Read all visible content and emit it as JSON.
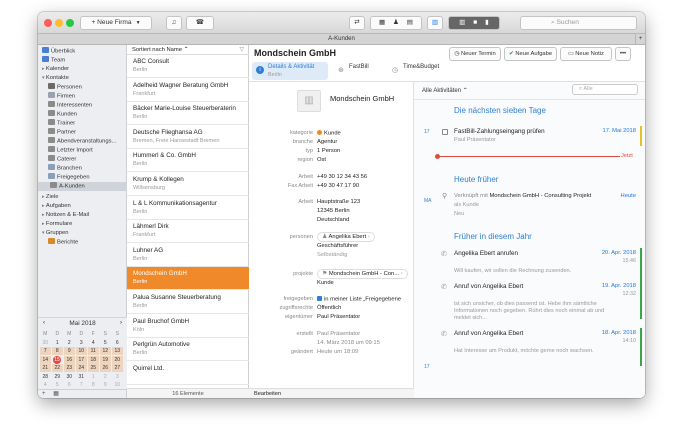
{
  "toolbar": {
    "new_firm": "Neue Firma",
    "search_placeholder": "Suchen"
  },
  "tabbar": {
    "title": "A-Kunden"
  },
  "sidebar": {
    "items": [
      {
        "label": "Überblick",
        "icon": "home-icon"
      },
      {
        "label": "Team",
        "icon": "team-icon"
      },
      {
        "label": "Kalender",
        "icon": "disclosure-icon"
      },
      {
        "label": "Kontakte",
        "icon": "disclosure-open-icon"
      },
      {
        "label": "Personen",
        "icon": "person-icon"
      },
      {
        "label": "Firmen",
        "icon": "company-icon"
      },
      {
        "label": "Interessenten",
        "icon": "person-group-icon"
      },
      {
        "label": "Kunden",
        "icon": "person-group-icon"
      },
      {
        "label": "Trainer",
        "icon": "person-group-icon"
      },
      {
        "label": "Partner",
        "icon": "person-group-icon"
      },
      {
        "label": "Abendveranstaltungs...",
        "icon": "person-group-icon"
      },
      {
        "label": "Letzter Import",
        "icon": "person-group-icon"
      },
      {
        "label": "Caterer",
        "icon": "person-group-icon"
      },
      {
        "label": "Branchen",
        "icon": "folder-icon"
      },
      {
        "label": "Freigegeben",
        "icon": "folder-icon"
      },
      {
        "label": "A-Kunden",
        "icon": "person-group-icon"
      },
      {
        "label": "Ziele",
        "icon": "disclosure-icon"
      },
      {
        "label": "Aufgaben",
        "icon": "disclosure-icon"
      },
      {
        "label": "Notizen & E-Mail",
        "icon": "disclosure-icon"
      },
      {
        "label": "Formulare",
        "icon": "disclosure-icon"
      },
      {
        "label": "Gruppen",
        "icon": "disclosure-open-icon"
      },
      {
        "label": "Berichte",
        "icon": "report-icon"
      }
    ],
    "calendar": {
      "title": "Mai 2018",
      "weekdays": [
        "M",
        "D",
        "M",
        "D",
        "F",
        "S",
        "S"
      ],
      "rows": [
        [
          "30",
          "1",
          "2",
          "3",
          "4",
          "5",
          "6"
        ],
        [
          "7",
          "8",
          "9",
          "10",
          "11",
          "12",
          "13"
        ],
        [
          "14",
          "15",
          "16",
          "17",
          "18",
          "19",
          "20"
        ],
        [
          "21",
          "22",
          "23",
          "24",
          "25",
          "26",
          "27"
        ],
        [
          "28",
          "29",
          "30",
          "31",
          "1",
          "2",
          "3"
        ],
        [
          "4",
          "5",
          "6",
          "7",
          "8",
          "9",
          "10"
        ]
      ],
      "today": "15"
    }
  },
  "list": {
    "sort_label": "Sortiert nach Name",
    "count": "16 Elemente",
    "items": [
      {
        "name": "ABC Consult",
        "city": "Berlin"
      },
      {
        "name": "Adelheid Wagner Beratung GmbH",
        "city": "Frankfurt"
      },
      {
        "name": "Bäcker Marie-Louise Steuerberaterin",
        "city": "Berlin"
      },
      {
        "name": "Deutsche Flieghansa AG",
        "city": "Bremen, Freie Hansestadt Bremen"
      },
      {
        "name": "Hummerl & Co. GmbH",
        "city": "Berlin"
      },
      {
        "name": "Krump & Kollegen",
        "city": "Willsensburg"
      },
      {
        "name": "L & L Kommunikationsagentur",
        "city": "Berlin"
      },
      {
        "name": "Lähmerl Dirk",
        "city": "Frankfurt"
      },
      {
        "name": "Luhner AG",
        "city": "Berlin"
      },
      {
        "name": "Mondschein GmbH",
        "city": "Berlin"
      },
      {
        "name": "Palua Susanne Steuerberatung",
        "city": "Berlin"
      },
      {
        "name": "Paul Bruchof GmbH",
        "city": "Köln"
      },
      {
        "name": "Perlgrün Automotive",
        "city": "Berlin"
      },
      {
        "name": "Quirrel Ltd.",
        "city": ""
      }
    ],
    "selected_index": 9
  },
  "detail": {
    "title": "Mondschein GmbH",
    "buttons": {
      "new_meeting": "Neuer Termin",
      "new_task": "Neue Aufgabe",
      "new_note": "Neue Notiz"
    },
    "tabs": [
      {
        "label": "Details & Aktivität",
        "sub": "Berlin"
      },
      {
        "label": "FastBill",
        "sub": ""
      },
      {
        "label": "Time&Budget",
        "sub": ""
      }
    ],
    "company_name": "Mondschein GmbH",
    "fields": {
      "kategorie_label": "kategorie",
      "kategorie": "Kunde",
      "branche_label": "branche",
      "branche": "Agentur",
      "typ_label": "typ",
      "typ": "1 Person",
      "region_label": "region",
      "region": "Ost",
      "phone_label": "Arbeit",
      "phone": "+49 30 12 34 43 56",
      "fax_label": "Fax Arbeit",
      "fax": "+49 30 47 17 90",
      "addr_label": "Arbeit",
      "addr1": "Hauptstraße 123",
      "addr2": "12345 Berlin",
      "addr3": "Deutschland",
      "persons_label": "personen",
      "person": "Angelika Ebert",
      "person_role": "Geschäftsführer",
      "person_status": "Selbständig",
      "projects_label": "projekte",
      "project": "Mondschein GmbH - Con...",
      "project_kind": "Kunde",
      "shared_label": "freigegeben",
      "shared": "in meiner Liste „Freigegebene",
      "access_label": "zugriffsrechte",
      "access": "Öffentlich",
      "owner_label": "eigentümer",
      "owner": "Paul Präsentator",
      "created_label": "erstellt",
      "created": "Paul Präsentator",
      "created_date": "14. März 2018 um 09:15",
      "changed_label": "geändert",
      "changed": "Heute um 18:09"
    },
    "edit_label": "Bearbeiten",
    "activities": {
      "filter_label": "Alle Aktivitäten",
      "search_placeholder": "Alle",
      "section_next": "Die nächsten sieben Tage",
      "task_title": "FastBill-Zahlungseingang prüfen",
      "task_owner": "Paul Präsentator",
      "task_date": "17. Mai 2018",
      "now_label": "Jetzt",
      "section_today": "Heute früher",
      "link_prefix": "Verknüpft mit",
      "link_target": "Mondschein GmbH - Consulting Projekt",
      "link_sub1": "als Kunde",
      "link_sub2": "Neu",
      "link_date": "Heute",
      "section_year": "Früher in diesem Jahr",
      "entries": [
        {
          "title": "Angelika Ebert anrufen",
          "date": "20. Apr. 2018",
          "time": "15:46",
          "text": "Will kaufen, wir sollen die Rechnung zusenden."
        },
        {
          "title": "Anruf von Angelika Ebert",
          "date": "19. Apr. 2018",
          "time": "12:32",
          "text": "ist sich unsicher, ob dies passend ist. Hebe ihm sämtliche Informationen noch gegeben. Rührt dies noch einmal ab und meldet sich..."
        },
        {
          "title": "Anruf von Angelika Ebert",
          "date": "18. Apr. 2018",
          "time": "14:10",
          "text": "Hat Interesse am Produkt, möchte gerne noch wachsen."
        }
      ],
      "left_dates": [
        "17",
        "MA",
        "17"
      ]
    }
  }
}
